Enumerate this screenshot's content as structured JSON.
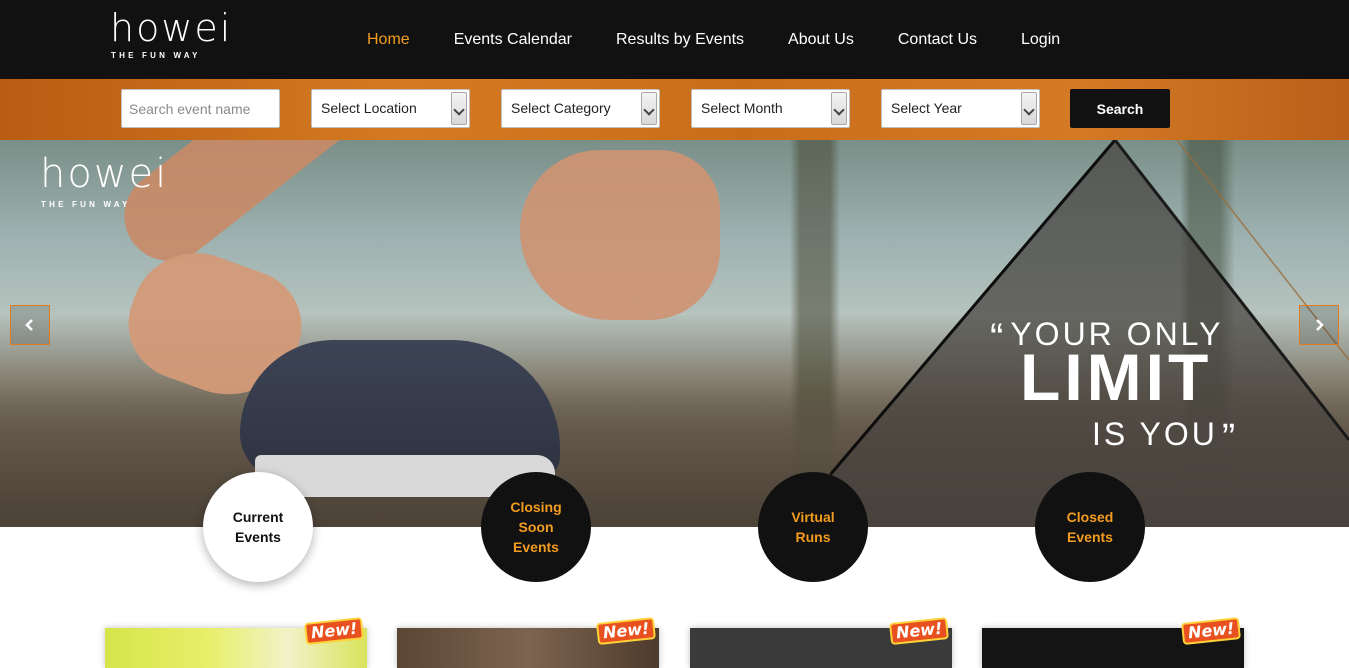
{
  "brand": {
    "name": "howei",
    "tagline": "THE FUN WAY"
  },
  "nav": {
    "items": [
      {
        "label": "Home",
        "active": true
      },
      {
        "label": "Events Calendar",
        "active": false
      },
      {
        "label": "Results by Events",
        "active": false
      },
      {
        "label": "About Us",
        "active": false
      },
      {
        "label": "Contact Us",
        "active": false
      },
      {
        "label": "Login",
        "active": false
      }
    ]
  },
  "search": {
    "placeholder": "Search event name",
    "location": "Select Location",
    "category": "Select Category",
    "month": "Select Month",
    "year": "Select Year",
    "button": "Search"
  },
  "hero": {
    "quote_line1": "YOUR ONLY",
    "quote_line2": "LIMIT",
    "quote_line3": "IS YOU",
    "open_quote": "“",
    "close_quote": "”"
  },
  "categories": [
    {
      "label": "Current\nEvents",
      "active": true
    },
    {
      "label": "Closing\nSoon\nEvents",
      "active": false
    },
    {
      "label": "Virtual\nRuns",
      "active": false
    },
    {
      "label": "Closed\nEvents",
      "active": false
    }
  ],
  "cards": [
    {
      "badge": "New!"
    },
    {
      "badge": "New!"
    },
    {
      "badge": "New!"
    },
    {
      "badge": "New!"
    }
  ],
  "colors": {
    "accent": "#f39c1f",
    "header_bg": "#111111",
    "search_bar": "#c96d1a",
    "carousel_border": "#e07b1f"
  },
  "icons": {
    "prev": "chevron-left-icon",
    "next": "chevron-right-icon"
  }
}
